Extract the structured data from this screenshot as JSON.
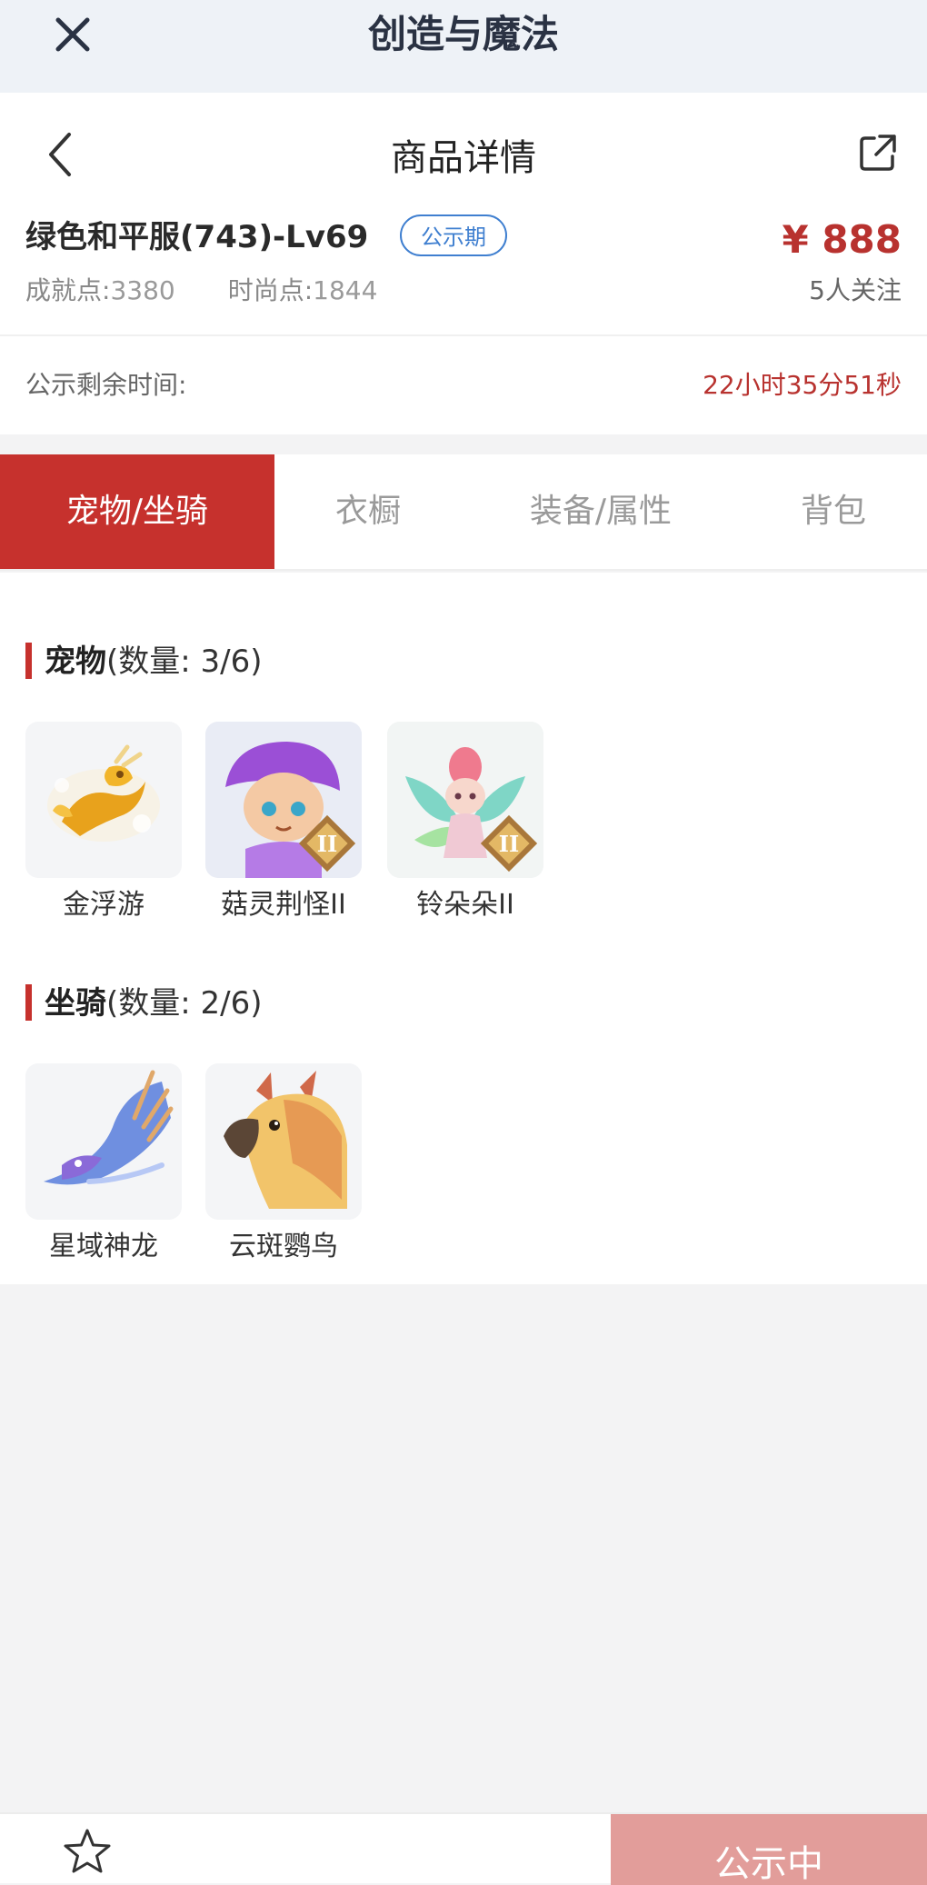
{
  "app": {
    "title": "创造与魔法"
  },
  "header": {
    "title": "商品详情",
    "item_name": "绿色和平服(743)-Lv69",
    "badge": "公示期",
    "price": "¥ 888",
    "achievement_label": "成就点:",
    "achievement_value": "3380",
    "fashion_label": "时尚点:",
    "fashion_value": "1844",
    "followers": "5人关注",
    "countdown_label": "公示剩余时间:",
    "countdown_value": "22小时35分51秒"
  },
  "tabs": [
    {
      "label": "宠物/坐骑",
      "active": true
    },
    {
      "label": "衣橱",
      "active": false
    },
    {
      "label": "装备/属性",
      "active": false
    },
    {
      "label": "背包",
      "active": false
    }
  ],
  "pets": {
    "title": "宠物",
    "count_text": "(数量: 3/6)",
    "items": [
      {
        "name": "金浮游",
        "icon": "golden-dragon-icon"
      },
      {
        "name": "菇灵荆怪II",
        "icon": "mushroom-sprite-icon",
        "tier": "II"
      },
      {
        "name": "铃朵朵II",
        "icon": "flower-fairy-icon",
        "tier": "II"
      }
    ]
  },
  "mounts": {
    "title": "坐骑",
    "count_text": "(数量: 2/6)",
    "items": [
      {
        "name": "星域神龙",
        "icon": "star-dragon-icon"
      },
      {
        "name": "云斑鹦鸟",
        "icon": "parrot-icon"
      }
    ]
  },
  "bottom": {
    "status_label": "公示中"
  },
  "colors": {
    "accent": "#c6312d",
    "price": "#b8322f",
    "badge": "#3f7fd0",
    "topbar": "#eef2f7"
  }
}
